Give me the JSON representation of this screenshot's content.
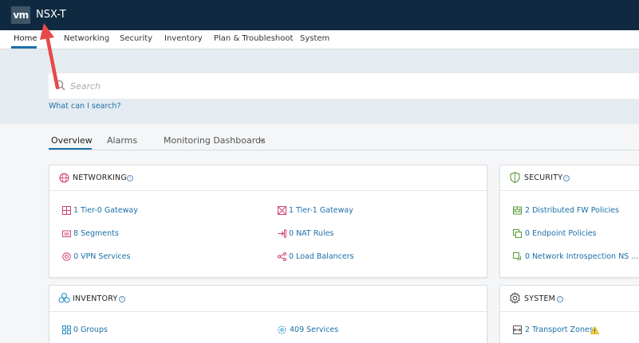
{
  "header": {
    "logo": "vm",
    "title": "NSX-T"
  },
  "nav": {
    "items": [
      {
        "label": "Home",
        "active": true
      },
      {
        "label": "Networking"
      },
      {
        "label": "Security"
      },
      {
        "label": "Inventory"
      },
      {
        "label": "Plan & Troubleshoot"
      },
      {
        "label": "System"
      }
    ]
  },
  "search": {
    "placeholder": "Search",
    "help_link": "What can I search?"
  },
  "subtabs": [
    {
      "label": "Overview",
      "active": true
    },
    {
      "label": "Alarms"
    },
    {
      "label": "Monitoring Dashboards"
    }
  ],
  "cards": {
    "networking": {
      "title": "NETWORKING",
      "items": [
        "1 Tier-0 Gateway",
        "1 Tier-1 Gateway",
        "8 Segments",
        "0 NAT Rules",
        "0 VPN Services",
        "0 Load Balancers"
      ]
    },
    "security": {
      "title": "SECURITY",
      "items": [
        "2 Distributed FW Policies",
        "0 Endpoint Policies",
        "0 Network Introspection NS ..."
      ]
    },
    "inventory": {
      "title": "INVENTORY",
      "items": [
        "0 Groups",
        "409 Services"
      ]
    },
    "system": {
      "title": "SYSTEM",
      "items": [
        "2 Transport Zones"
      ]
    }
  },
  "colors": {
    "topbar": "#0f2a40",
    "accent": "#1b6fa8",
    "annotation_arrow": "#e8484a",
    "icon_pink": "#d0446e",
    "icon_green": "#5a9a3a",
    "icon_cyan": "#2a8fc4",
    "warning": "#f2c200"
  }
}
